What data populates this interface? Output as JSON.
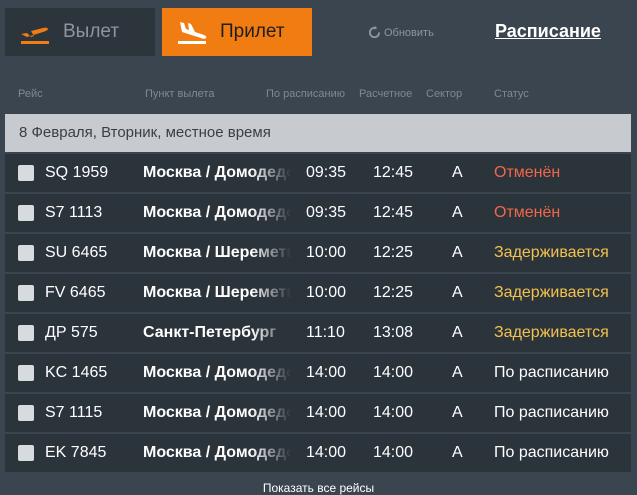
{
  "tabs": {
    "departure_label": "Вылет",
    "arrival_label": "Прилет"
  },
  "refresh_label": "Обновить",
  "schedule_link": "Расписание",
  "columns": {
    "flight": "Рейс",
    "origin": "Пункт вылета",
    "scheduled": "По расписанию",
    "estimated": "Расчетное",
    "sector": "Сектор",
    "status": "Статус"
  },
  "date_header": "8 Февраля, Вторник, местное время",
  "flights": [
    {
      "flight": "SQ 1959",
      "city": "Москва / Домодедово",
      "scheduled": "09:35",
      "estimated": "12:45",
      "sector": "А",
      "status": "Отменён",
      "status_type": "cancel",
      "airline_icon": "sq-logo-icon"
    },
    {
      "flight": "S7 1113",
      "city": "Москва / Домодедово",
      "scheduled": "09:35",
      "estimated": "12:45",
      "sector": "А",
      "status": "Отменён",
      "status_type": "cancel",
      "airline_icon": "s7-logo-icon"
    },
    {
      "flight": "SU 6465",
      "city": "Москва / Шереметьево",
      "scheduled": "10:00",
      "estimated": "12:25",
      "sector": "А",
      "status": "Задерживается",
      "status_type": "delay",
      "airline_icon": "su-logo-icon"
    },
    {
      "flight": "FV 6465",
      "city": "Москва / Шереметьево",
      "scheduled": "10:00",
      "estimated": "12:25",
      "sector": "А",
      "status": "Задерживается",
      "status_type": "delay",
      "airline_icon": "fv-logo-icon"
    },
    {
      "flight": "ДР 575",
      "city": "Санкт-Петербург",
      "scheduled": "11:10",
      "estimated": "13:08",
      "sector": "А",
      "status": "Задерживается",
      "status_type": "delay",
      "airline_icon": "dp-logo-icon"
    },
    {
      "flight": "KC 1465",
      "city": "Москва / Домодедово",
      "scheduled": "14:00",
      "estimated": "14:00",
      "sector": "А",
      "status": "По расписанию",
      "status_type": "ok",
      "airline_icon": "kc-logo-icon"
    },
    {
      "flight": "S7 1115",
      "city": "Москва / Домодедово",
      "scheduled": "14:00",
      "estimated": "14:00",
      "sector": "А",
      "status": "По расписанию",
      "status_type": "ok",
      "airline_icon": "s7-logo-icon"
    },
    {
      "flight": "EK 7845",
      "city": "Москва / Домодедово",
      "scheduled": "14:00",
      "estimated": "14:00",
      "sector": "А",
      "status": "По расписанию",
      "status_type": "ok",
      "airline_icon": "ek-logo-icon"
    }
  ],
  "show_all_label": "Показать все рейсы",
  "colors": {
    "background": "#3b4550",
    "arrival_tab": "#f07c12",
    "departure_tab": "#2c343c",
    "row": "#2b333b",
    "date_bar": "#c7cbd0",
    "cancel": "#f0674a",
    "delay": "#f4c24d"
  }
}
